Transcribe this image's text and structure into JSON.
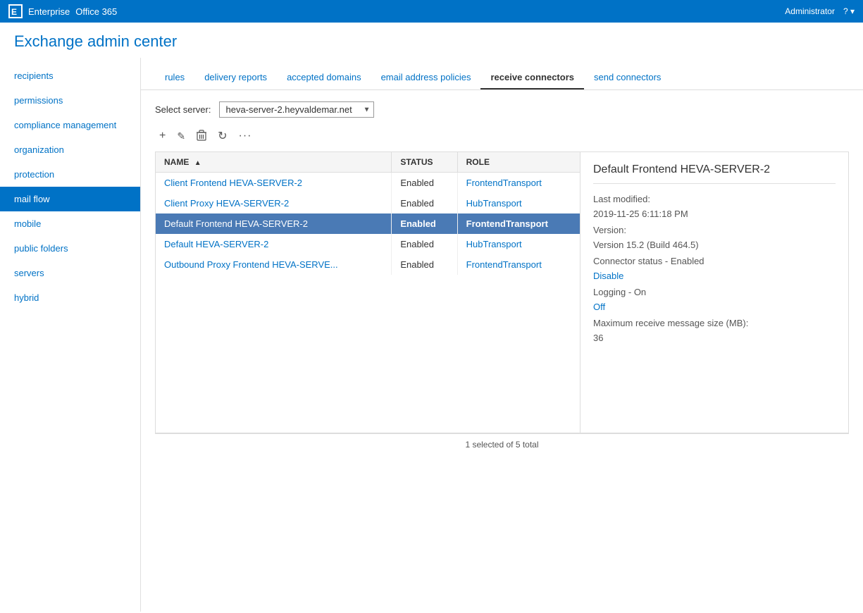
{
  "topbar": {
    "logo": "E",
    "app1": "Enterprise",
    "app2": "Office 365",
    "user": "Administrator",
    "help": "?"
  },
  "page": {
    "title": "Exchange admin center"
  },
  "sidebar": {
    "items": [
      {
        "id": "recipients",
        "label": "recipients"
      },
      {
        "id": "permissions",
        "label": "permissions"
      },
      {
        "id": "compliance-management",
        "label": "compliance management"
      },
      {
        "id": "organization",
        "label": "organization"
      },
      {
        "id": "protection",
        "label": "protection"
      },
      {
        "id": "mail-flow",
        "label": "mail flow",
        "active": true
      },
      {
        "id": "mobile",
        "label": "mobile"
      },
      {
        "id": "public-folders",
        "label": "public folders"
      },
      {
        "id": "servers",
        "label": "servers"
      },
      {
        "id": "hybrid",
        "label": "hybrid"
      }
    ]
  },
  "subnav": {
    "items": [
      {
        "id": "rules",
        "label": "rules"
      },
      {
        "id": "delivery-reports",
        "label": "delivery reports"
      },
      {
        "id": "accepted-domains",
        "label": "accepted domains"
      },
      {
        "id": "email-address-policies",
        "label": "email address policies"
      },
      {
        "id": "receive-connectors",
        "label": "receive connectors",
        "active": true
      },
      {
        "id": "send-connectors",
        "label": "send connectors"
      }
    ]
  },
  "server_select": {
    "label": "Select server:",
    "value": "heva-server-2.heyvaldemar.net",
    "options": [
      "heva-server-2.heyvaldemar.net"
    ]
  },
  "toolbar": {
    "add": "+",
    "edit": "✎",
    "delete": "🗑",
    "refresh": "↻",
    "more": "···"
  },
  "table": {
    "columns": [
      {
        "id": "name",
        "label": "NAME",
        "sort": "asc"
      },
      {
        "id": "status",
        "label": "STATUS"
      },
      {
        "id": "role",
        "label": "ROLE"
      }
    ],
    "rows": [
      {
        "name": "Client Frontend HEVA-SERVER-2",
        "status": "Enabled",
        "role": "FrontendTransport",
        "selected": false
      },
      {
        "name": "Client Proxy HEVA-SERVER-2",
        "status": "Enabled",
        "role": "HubTransport",
        "selected": false
      },
      {
        "name": "Default Frontend HEVA-SERVER-2",
        "status": "Enabled",
        "role": "FrontendTransport",
        "selected": true
      },
      {
        "name": "Default HEVA-SERVER-2",
        "status": "Enabled",
        "role": "HubTransport",
        "selected": false
      },
      {
        "name": "Outbound Proxy Frontend HEVA-SERVE...",
        "status": "Enabled",
        "role": "FrontendTransport",
        "selected": false
      }
    ],
    "status_text": "1 selected of 5 total"
  },
  "detail": {
    "title": "Default Frontend HEVA-SERVER-2",
    "last_modified_label": "Last modified:",
    "last_modified_value": "2019-11-25 6:11:18 PM",
    "version_label": "Version:",
    "version_value": "Version 15.2 (Build 464.5)",
    "connector_status": "Connector status - Enabled",
    "disable_link": "Disable",
    "logging_label": "Logging - On",
    "off_link": "Off",
    "max_size_label": "Maximum receive message size (MB):",
    "max_size_value": "36"
  }
}
